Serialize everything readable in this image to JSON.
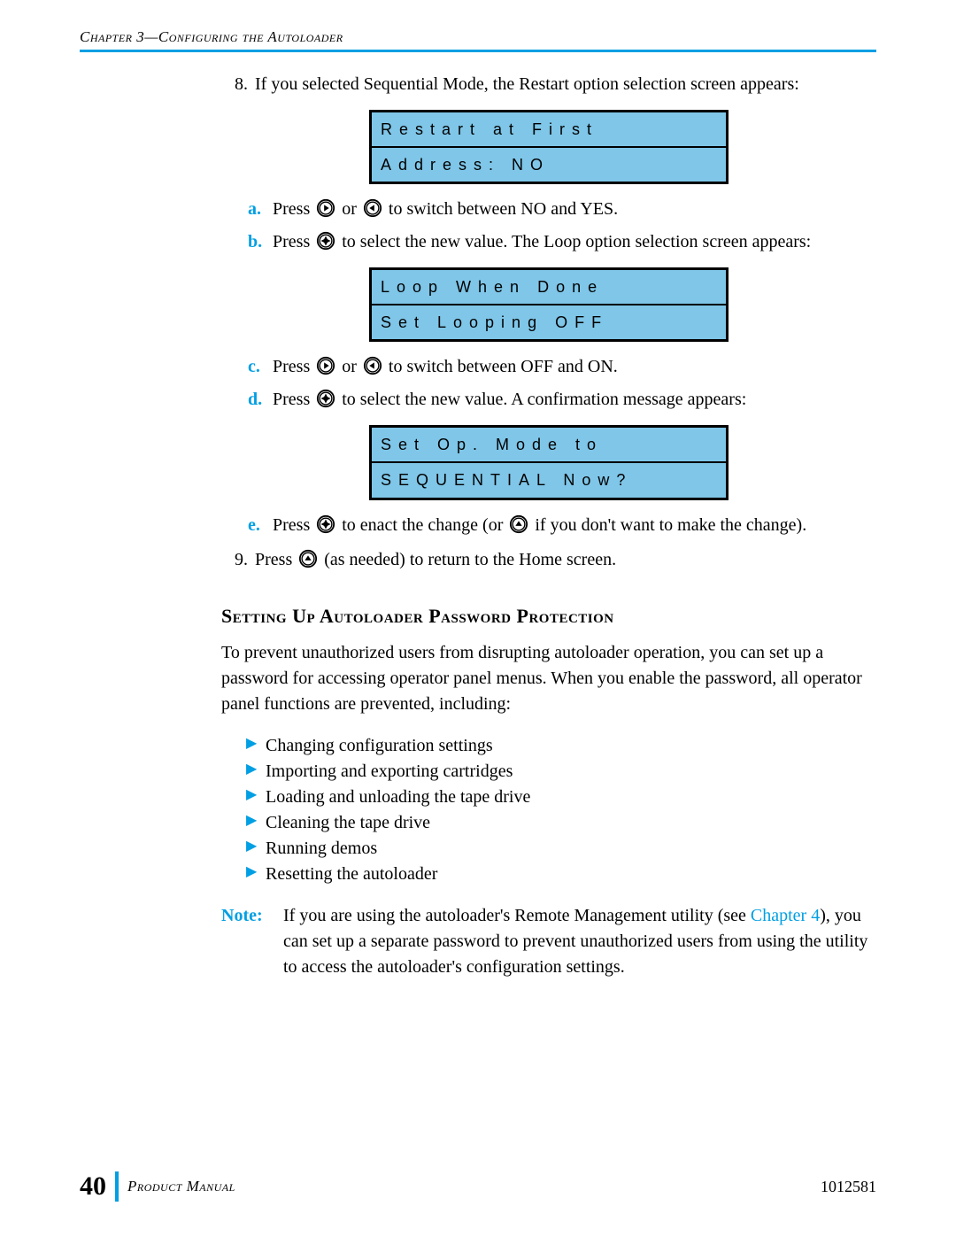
{
  "header": "Chapter 3—Configuring the Autoloader",
  "step8": {
    "num": "8.",
    "text": "If you selected Sequential Mode, the Restart option selection screen appears:"
  },
  "lcd1": {
    "row1": "Restart at First",
    "row2": "Address: NO"
  },
  "sub_a": {
    "label": "a.",
    "before": "Press ",
    "mid": " or ",
    "after": " to switch between NO and YES."
  },
  "sub_b": {
    "label": "b.",
    "before": "Press ",
    "after": " to select the new value. The Loop option selection screen appears:"
  },
  "lcd2": {
    "row1": "Loop When Done",
    "row2": "Set Looping OFF"
  },
  "sub_c": {
    "label": "c.",
    "before": "Press ",
    "mid": " or ",
    "after": " to switch between OFF and ON."
  },
  "sub_d": {
    "label": "d.",
    "before": "Press ",
    "after": " to select the new value. A confirmation message appears:"
  },
  "lcd3": {
    "row1": "Set Op. Mode to",
    "row2": "SEQUENTIAL Now?"
  },
  "sub_e": {
    "label": "e.",
    "before": "Press ",
    "mid": " to enact the change (or ",
    "after": " if you don't want to make the change)."
  },
  "step9": {
    "num": "9.",
    "before": "Press ",
    "after": " (as needed) to return to the Home screen."
  },
  "section_heading": "Setting Up Autoloader Password Protection",
  "intro": "To prevent unauthorized users from disrupting autoloader operation, you can set up a password for accessing operator panel menus. When you enable the password, all operator panel functions are prevented, including:",
  "bullets": [
    "Changing configuration settings",
    "Importing and exporting cartridges",
    "Loading and unloading the tape drive",
    "Cleaning the tape drive",
    "Running demos",
    "Resetting the autoloader"
  ],
  "note": {
    "label": "Note:",
    "before": "If you are using the autoloader's Remote Management utility (see ",
    "link": "Chapter 4",
    "after": "), you can set up a separate password to prevent unauthorized users from using the utility to access the autoloader's configuration settings."
  },
  "footer": {
    "page": "40",
    "title": "Product Manual",
    "doc": "1012581"
  }
}
